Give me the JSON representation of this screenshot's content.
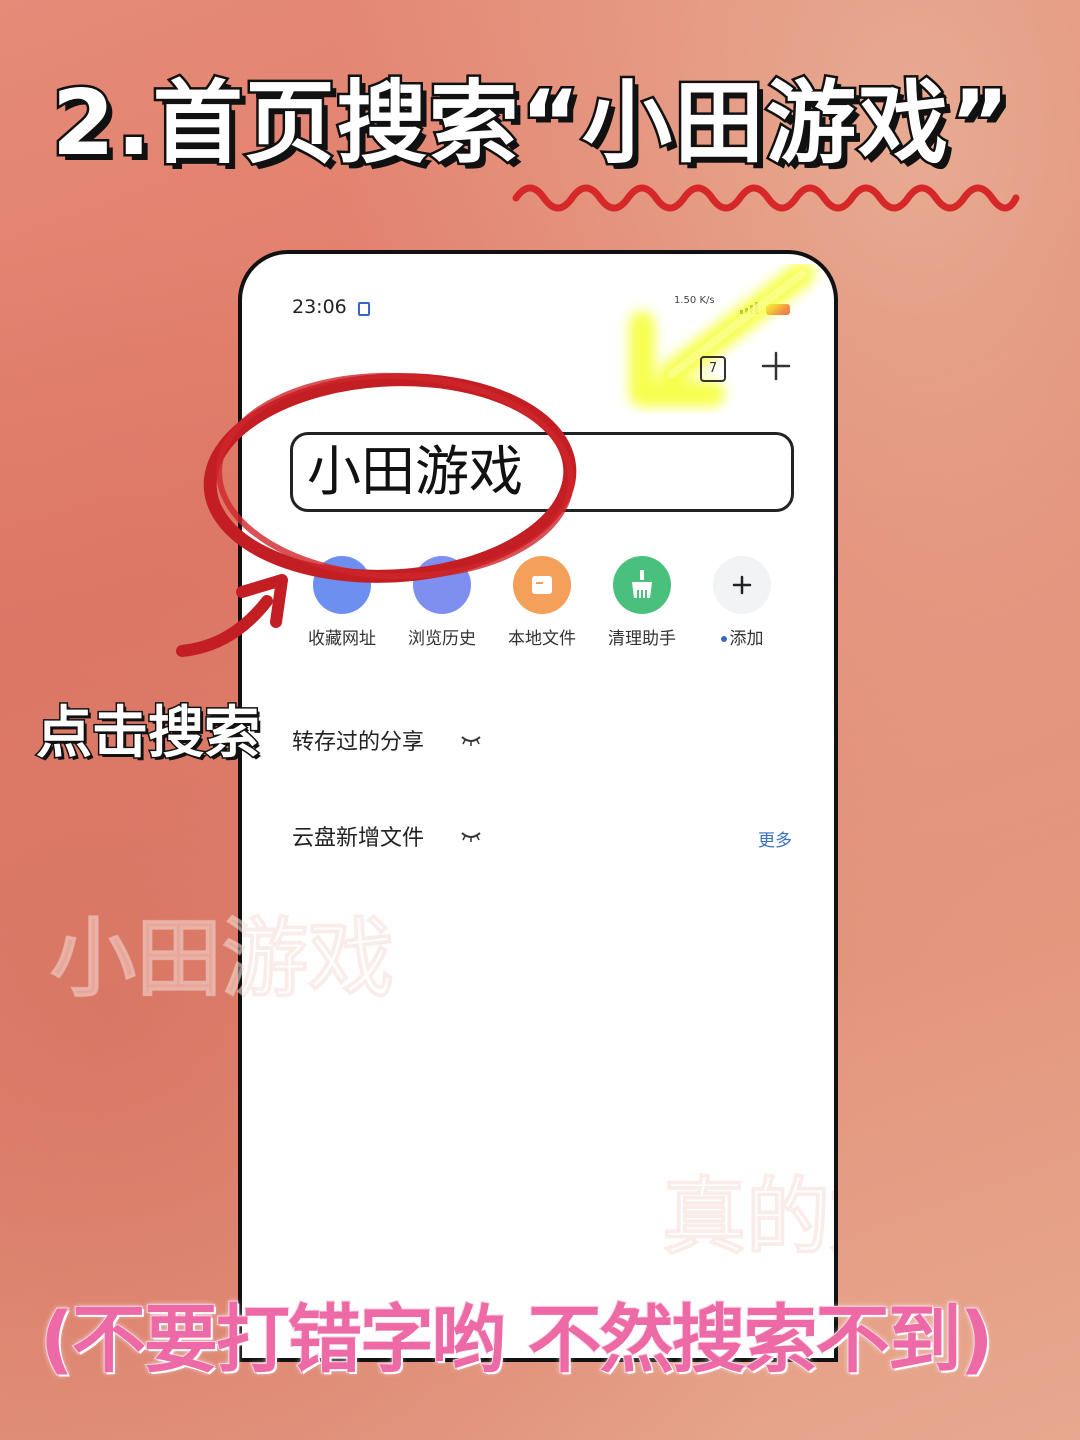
{
  "title": "2.首页搜索“小田游戏”",
  "annotation": {
    "click_hint": "点击搜索",
    "footer_note": "(不要打错字哟 不然搜索不到)"
  },
  "status_bar": {
    "time": "23:06",
    "net_speed": "1.50 K/s"
  },
  "toolbar": {
    "tabs_count": "7",
    "add_icon": "plus-icon"
  },
  "search": {
    "value": "小田游戏"
  },
  "shortcuts": [
    {
      "label": "收藏网址",
      "icon": "bookmark-icon",
      "color": "#6d8ff0"
    },
    {
      "label": "浏览历史",
      "icon": "history-icon",
      "color": "#7f8ff0"
    },
    {
      "label": "本地文件",
      "icon": "folder-icon",
      "color": "#f5a05a"
    },
    {
      "label": "清理助手",
      "icon": "broom-icon",
      "color": "#49c07c"
    },
    {
      "label": "添加",
      "icon": "add-icon",
      "color": "#f2f3f5"
    }
  ],
  "sections": {
    "saved_shares": "转存过的分享",
    "cloud_new_files": "云盘新增文件",
    "more_label": "更多"
  },
  "watermarks": {
    "primary": "小田游戏",
    "secondary": "真的好玩"
  },
  "colors": {
    "annotation_red": "#d0262c",
    "title_squiggle": "#d62828",
    "highlight_yellow": "#f5ff2e",
    "link_blue": "#3a6fc4"
  }
}
